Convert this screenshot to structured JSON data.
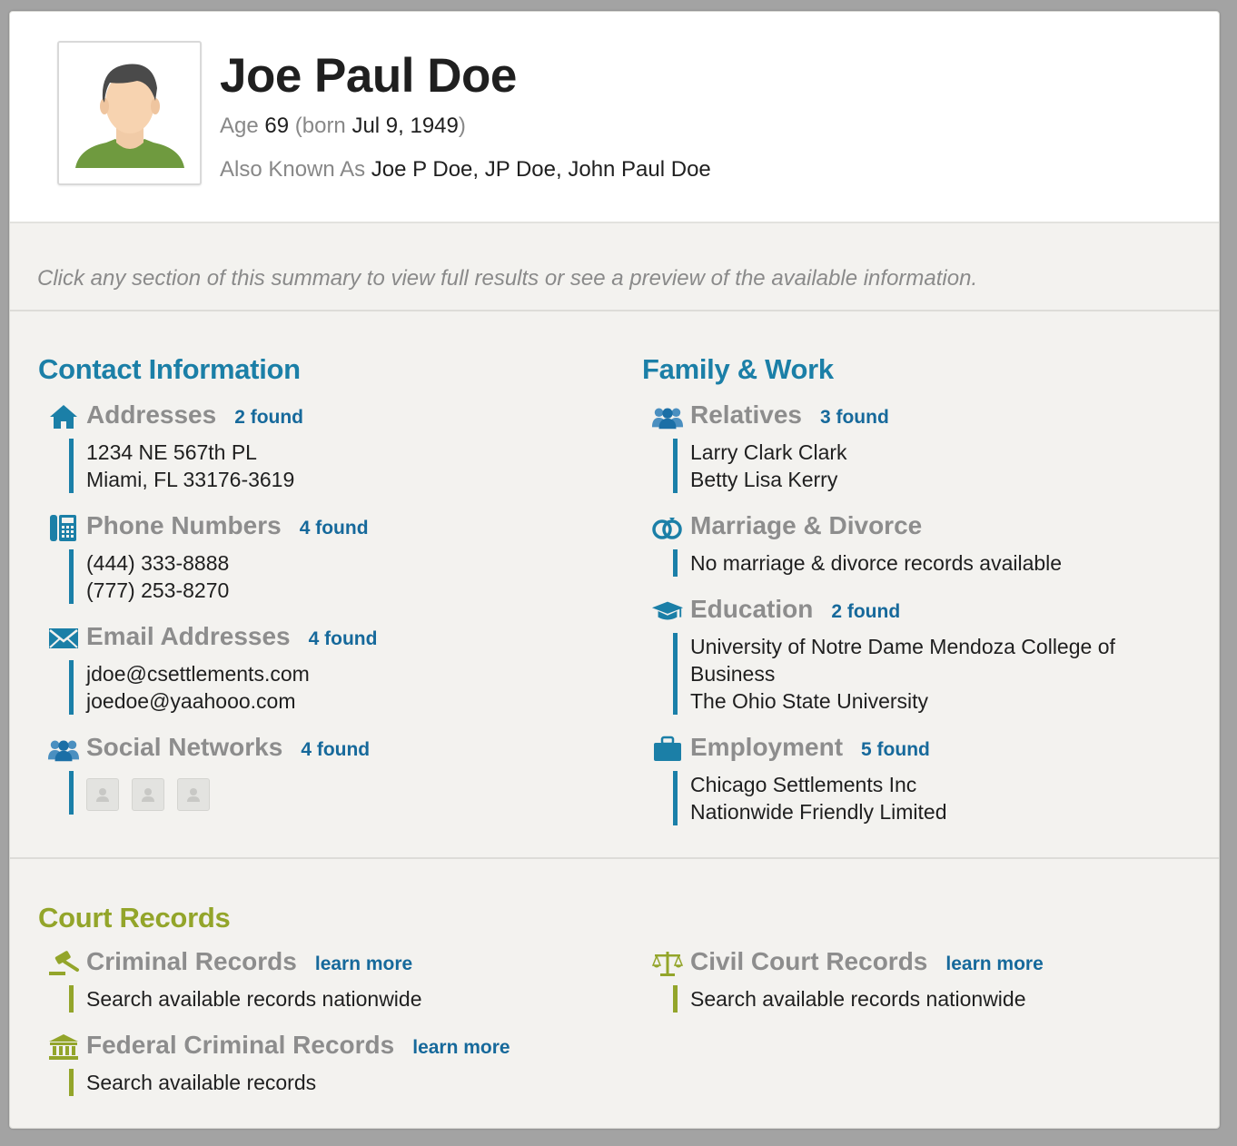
{
  "profile": {
    "name": "Joe Paul Doe",
    "age_label": "Age",
    "age": "69",
    "born_prefix": "(born",
    "born_date": "Jul 9, 1949",
    "born_suffix": ")",
    "aka_label": "Also Known As",
    "aka_value": "Joe P Doe, JP Doe, John Paul Doe"
  },
  "hint": "Click any section of this summary to view full results or see a preview of the available information.",
  "contact": {
    "title": "Contact Information",
    "addresses": {
      "title": "Addresses",
      "count": "2 found",
      "lines": [
        "1234 NE 567th PL",
        "Miami, FL 33176-3619"
      ]
    },
    "phones": {
      "title": "Phone Numbers",
      "count": "4 found",
      "lines": [
        "(444) 333-8888",
        "(777) 253-8270"
      ]
    },
    "emails": {
      "title": "Email Addresses",
      "count": "4 found",
      "lines": [
        "jdoe@csettlements.com",
        "joedoe@yaahooo.com"
      ]
    },
    "social": {
      "title": "Social Networks",
      "count": "4 found"
    }
  },
  "family": {
    "title": "Family & Work",
    "relatives": {
      "title": "Relatives",
      "count": "3 found",
      "lines": [
        "Larry Clark Clark",
        "Betty Lisa Kerry"
      ]
    },
    "marriage": {
      "title": "Marriage & Divorce",
      "lines": [
        "No marriage & divorce records available"
      ]
    },
    "education": {
      "title": "Education",
      "count": "2 found",
      "lines": [
        "University of Notre Dame Mendoza College of Business",
        "The Ohio State University"
      ]
    },
    "employment": {
      "title": "Employment",
      "count": "5 found",
      "lines": [
        "Chicago Settlements Inc",
        "Nationwide Friendly Limited"
      ]
    }
  },
  "court": {
    "title": "Court Records",
    "criminal": {
      "title": "Criminal Records",
      "link": "learn more",
      "line": "Search available records nationwide"
    },
    "federal": {
      "title": "Federal Criminal Records",
      "link": "learn more",
      "line": "Search available records"
    },
    "civil": {
      "title": "Civil Court Records",
      "link": "learn more",
      "line": "Search available records nationwide"
    }
  },
  "colors": {
    "accent_blue": "#1b7fa7",
    "link_blue": "#16699b",
    "accent_green": "#93a52a",
    "heading_gray": "#8d8d8d"
  },
  "icons": {
    "addresses": "house-icon",
    "phones": "phone-icon",
    "emails": "envelope-icon",
    "social": "people-icon",
    "relatives": "people-icon",
    "marriage": "rings-icon",
    "education": "graduation-cap-icon",
    "employment": "briefcase-icon",
    "criminal": "gavel-icon",
    "federal": "courthouse-icon",
    "civil": "scales-icon"
  }
}
